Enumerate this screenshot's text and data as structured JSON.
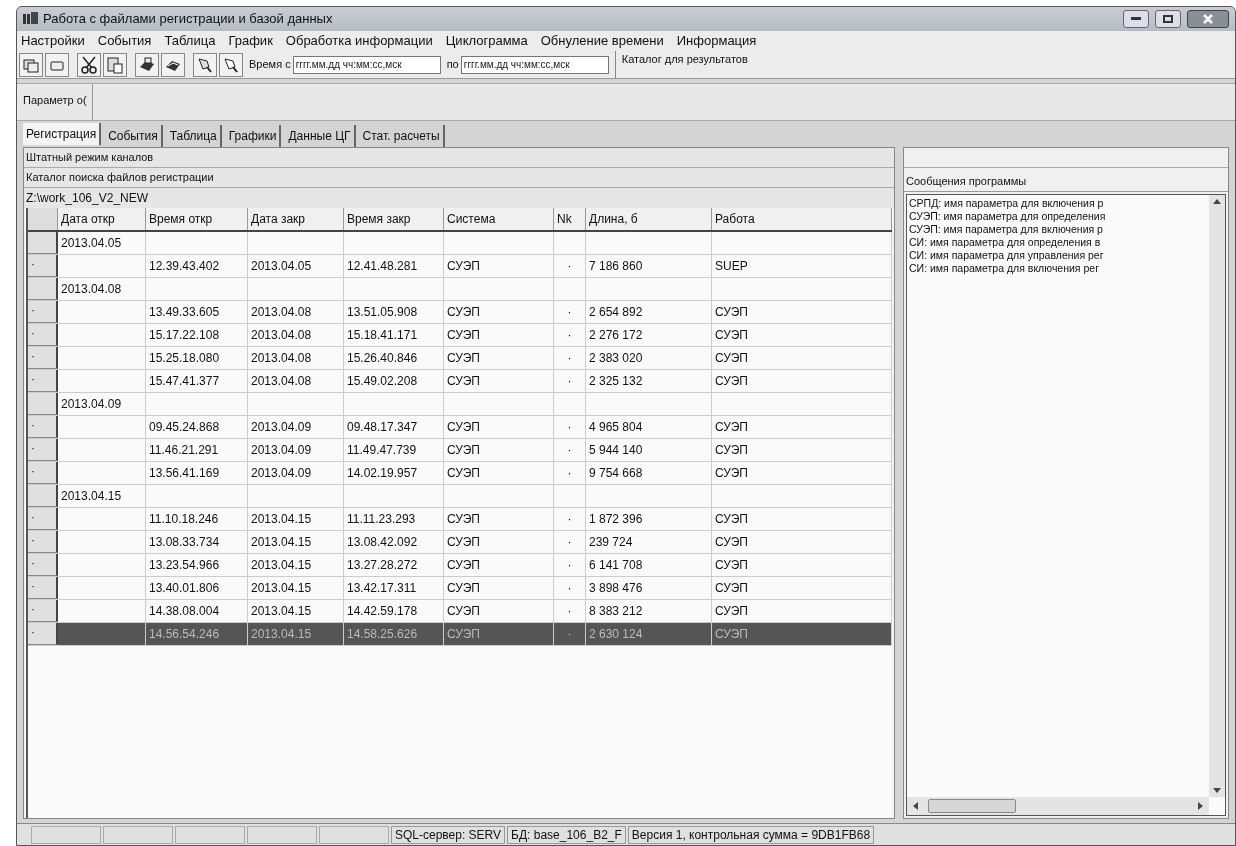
{
  "window": {
    "title": "Работа с файлами регистрации и базой данных"
  },
  "menu": [
    "Настройки",
    "События",
    "Таблица",
    "График",
    "Обработка информации",
    "Циклограмма",
    "Обнуление времени",
    "Информация"
  ],
  "toolbar": {
    "time_from_label": "Время с",
    "time_from_placeholder": "гггг.мм.дд чч:мм:сс,мск",
    "time_to_label": "по",
    "time_to_placeholder": "гггг.мм.дд чч:мм:сс,мск",
    "results_label": "Каталог для результатов"
  },
  "parameter_label": "Параметр о(",
  "tabs": [
    {
      "label": "Регистрация",
      "selected": true
    },
    {
      "label": "События",
      "selected": false
    },
    {
      "label": "Таблица",
      "selected": false
    },
    {
      "label": "Графики",
      "selected": false
    },
    {
      "label": "Данные ЦГ",
      "selected": false
    },
    {
      "label": "Стат. расчеты",
      "selected": false
    }
  ],
  "mode_label": "Штатный режим каналов",
  "catalog_label": "Каталог поиска файлов регистрации",
  "catalog_path": "Z:\\work_106_V2_NEW",
  "table": {
    "columns": [
      "Дата откр",
      "Время откр",
      "Дата закр",
      "Время закр",
      "Система",
      "Nk",
      "Длина, б",
      "Работа"
    ],
    "rows": [
      {
        "kind": "group",
        "marker": "",
        "selected": false,
        "cells": [
          "2013.04.05"
        ]
      },
      {
        "kind": "file",
        "marker": "·",
        "selected": false,
        "cells": [
          "",
          "12.39.43.402",
          "2013.04.05",
          "12.41.48.281",
          "СУЭП",
          "·",
          "7 186 860",
          "SUEP"
        ]
      },
      {
        "kind": "group",
        "marker": "",
        "selected": false,
        "cells": [
          "2013.04.08"
        ]
      },
      {
        "kind": "file",
        "marker": "·",
        "selected": false,
        "cells": [
          "",
          "13.49.33.605",
          "2013.04.08",
          "13.51.05.908",
          "СУЭП",
          "·",
          "2 654 892",
          "СУЭП"
        ]
      },
      {
        "kind": "file",
        "marker": "·",
        "selected": false,
        "cells": [
          "",
          "15.17.22.108",
          "2013.04.08",
          "15.18.41.171",
          "СУЭП",
          "·",
          "2 276 172",
          "СУЭП"
        ]
      },
      {
        "kind": "file",
        "marker": "·",
        "selected": false,
        "cells": [
          "",
          "15.25.18.080",
          "2013.04.08",
          "15.26.40.846",
          "СУЭП",
          "·",
          "2 383 020",
          "СУЭП"
        ]
      },
      {
        "kind": "file",
        "marker": "·",
        "selected": false,
        "cells": [
          "",
          "15.47.41.377",
          "2013.04.08",
          "15.49.02.208",
          "СУЭП",
          "·",
          "2 325 132",
          "СУЭП"
        ]
      },
      {
        "kind": "group",
        "marker": "",
        "selected": false,
        "cells": [
          "2013.04.09"
        ]
      },
      {
        "kind": "file",
        "marker": "·",
        "selected": false,
        "cells": [
          "",
          "09.45.24.868",
          "2013.04.09",
          "09.48.17.347",
          "СУЭП",
          "·",
          "4 965 804",
          "СУЭП"
        ]
      },
      {
        "kind": "file",
        "marker": "·",
        "selected": false,
        "cells": [
          "",
          "11.46.21.291",
          "2013.04.09",
          "11.49.47.739",
          "СУЭП",
          "·",
          "5 944 140",
          "СУЭП"
        ]
      },
      {
        "kind": "file",
        "marker": "·",
        "selected": false,
        "cells": [
          "",
          "13.56.41.169",
          "2013.04.09",
          "14.02.19.957",
          "СУЭП",
          "·",
          "9 754 668",
          "СУЭП"
        ]
      },
      {
        "kind": "group",
        "marker": "",
        "selected": false,
        "cells": [
          "2013.04.15"
        ]
      },
      {
        "kind": "file",
        "marker": "·",
        "selected": false,
        "cells": [
          "",
          "11.10.18.246",
          "2013.04.15",
          "11.11.23.293",
          "СУЭП",
          "·",
          "1 872 396",
          "СУЭП"
        ]
      },
      {
        "kind": "file",
        "marker": "·",
        "selected": false,
        "cells": [
          "",
          "13.08.33.734",
          "2013.04.15",
          "13.08.42.092",
          "СУЭП",
          "·",
          "239 724",
          "СУЭП"
        ]
      },
      {
        "kind": "file",
        "marker": "·",
        "selected": false,
        "cells": [
          "",
          "13.23.54.966",
          "2013.04.15",
          "13.27.28.272",
          "СУЭП",
          "·",
          "6 141 708",
          "СУЭП"
        ]
      },
      {
        "kind": "file",
        "marker": "·",
        "selected": false,
        "cells": [
          "",
          "13.40.01.806",
          "2013.04.15",
          "13.42.17.311",
          "СУЭП",
          "·",
          "3 898 476",
          "СУЭП"
        ]
      },
      {
        "kind": "file",
        "marker": "·",
        "selected": false,
        "cells": [
          "",
          "14.38.08.004",
          "2013.04.15",
          "14.42.59.178",
          "СУЭП",
          "·",
          "8 383 212",
          "СУЭП"
        ]
      },
      {
        "kind": "file",
        "marker": "·",
        "selected": true,
        "cells": [
          "",
          "14.56.54.246",
          "2013.04.15",
          "14.58.25.626",
          "СУЭП",
          "·",
          "2 630 124",
          "СУЭП"
        ]
      }
    ]
  },
  "messages": {
    "title": "Сообщения программы",
    "items": [
      "СРПД: имя параметра для включения р",
      "СУЭП: имя параметра для определения",
      "СУЭП: имя параметра для включения р",
      "СИ: имя параметра для определения в",
      "СИ: имя параметра для управления рег",
      "СИ: имя параметра для включения рег"
    ]
  },
  "status_bar": [
    "SQL-сервер: SERV",
    "БД: base_106_B2_F",
    "Версия 1, контрольная сумма = 9DB1FB68"
  ]
}
